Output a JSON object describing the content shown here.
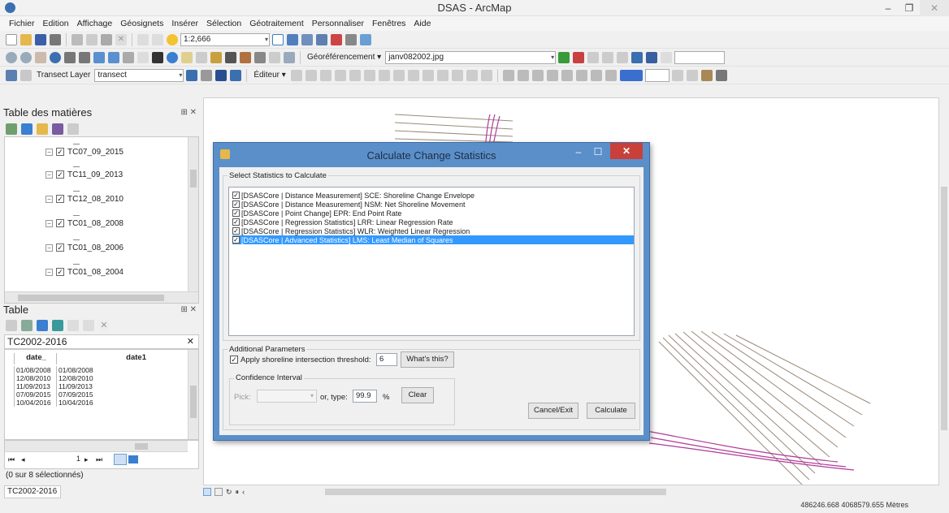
{
  "window": {
    "title": "DSAS - ArcMap"
  },
  "menubar": [
    "Fichier",
    "Edition",
    "Affichage",
    "Géosignets",
    "Insérer",
    "Sélection",
    "Géotraitement",
    "Personnaliser",
    "Fenêtres",
    "Aide"
  ],
  "toolbar1": {
    "scale": "1:2,666"
  },
  "toolbar2": {
    "georef_label": "Géoréférencement ▾",
    "georef_layer": "janv082002.jpg"
  },
  "toolbar3": {
    "transect_label": "Transect Layer",
    "transect_value": "transect",
    "editor_label": "Éditeur ▾"
  },
  "toc": {
    "title": "Table des matières",
    "layers": [
      "TC07_09_2015",
      "TC11_09_2013",
      "TC12_08_2010",
      "TC01_08_2008",
      "TC01_08_2006",
      "TC01_08_2004"
    ]
  },
  "table_panel": {
    "title": "Table",
    "tab": "TC2002-2016",
    "columns": [
      "date_",
      "date1"
    ],
    "rows": [
      [
        "01/08/2008",
        "01/08/2008"
      ],
      [
        "12/08/2010",
        "12/08/2010"
      ],
      [
        "11/09/2013",
        "11/09/2013"
      ],
      [
        "07/09/2015",
        "07/09/2015"
      ],
      [
        "10/04/2016",
        "10/04/2016"
      ]
    ],
    "record_nav": "1",
    "status": "(0 sur 8 sélectionnés)",
    "bottom_tab": "TC2002-2016"
  },
  "dialog": {
    "title": "Calculate Change Statistics",
    "select_label": "Select Statistics to Calculate",
    "statistics": [
      {
        "label": "[DSASCore | Distance Measurement] SCE: Shoreline Change Envelope",
        "checked": true,
        "selected": false
      },
      {
        "label": "[DSASCore | Distance Measurement] NSM: Net Shoreline Movement",
        "checked": true,
        "selected": false
      },
      {
        "label": "[DSASCore | Point Change] EPR: End Point Rate",
        "checked": true,
        "selected": false
      },
      {
        "label": "[DSASCore | Regression Statistics] LRR: Linear Regression Rate",
        "checked": true,
        "selected": false
      },
      {
        "label": "[DSASCore | Regression Statistics] WLR: Weighted Linear Regression",
        "checked": true,
        "selected": false
      },
      {
        "label": "[DSASCore | Advanced Statistics] LMS: Least Median of Squares",
        "checked": true,
        "selected": true
      }
    ],
    "additional_label": "Additional Parameters",
    "threshold_label": "Apply shoreline intersection threshold:",
    "threshold_value": "6",
    "whats_this": "What's this?",
    "confidence_label": "Confidence Interval",
    "pick_label": "Pick:",
    "or_type_label": "or, type:",
    "confidence_value": "99.9",
    "percent": "%",
    "clear": "Clear",
    "cancel": "Cancel/Exit",
    "calculate": "Calculate"
  },
  "status_coords": "486246.668  4068579.655 Mètres"
}
